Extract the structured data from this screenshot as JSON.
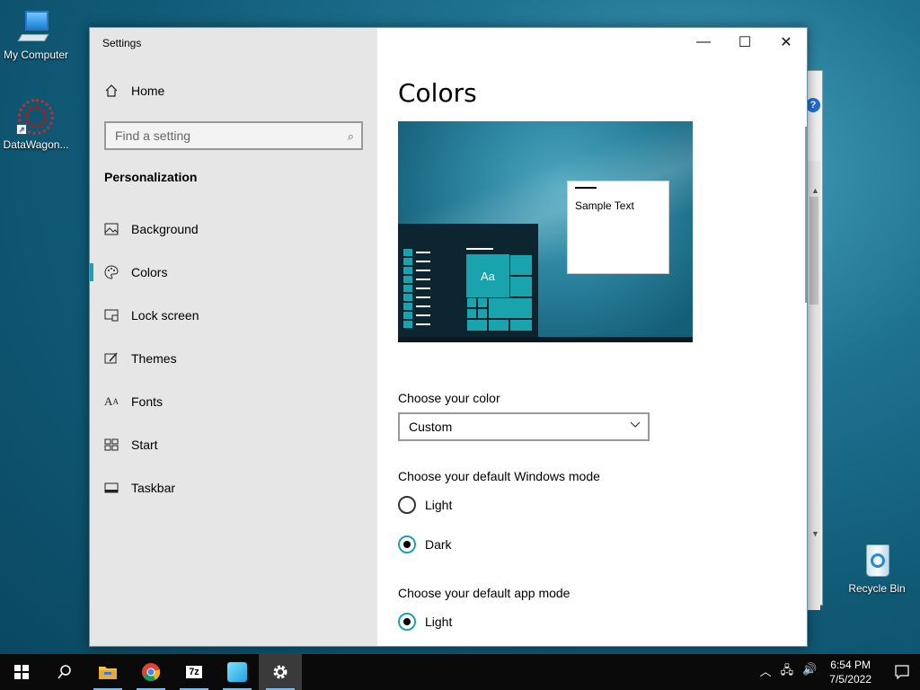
{
  "desktop": {
    "icons": [
      {
        "label": "My Computer"
      },
      {
        "label": "DataWagon..."
      },
      {
        "label": "Recycle Bin"
      }
    ]
  },
  "window": {
    "title": "Settings",
    "controls": {
      "minimize": "—",
      "maximize": "☐",
      "close": "✕"
    }
  },
  "sidebar": {
    "home_label": "Home",
    "search_placeholder": "Find a setting",
    "section": "Personalization",
    "items": [
      {
        "label": "Background",
        "icon": "image-icon"
      },
      {
        "label": "Colors",
        "icon": "palette-icon",
        "active": true
      },
      {
        "label": "Lock screen",
        "icon": "lock-screen-icon"
      },
      {
        "label": "Themes",
        "icon": "brush-icon"
      },
      {
        "label": "Fonts",
        "icon": "font-icon"
      },
      {
        "label": "Start",
        "icon": "start-icon"
      },
      {
        "label": "Taskbar",
        "icon": "taskbar-icon"
      }
    ]
  },
  "main": {
    "title": "Colors",
    "preview": {
      "sample_text": "Sample Text",
      "tile_text": "Aa"
    },
    "choose_color_label": "Choose your color",
    "choose_color_value": "Custom",
    "windows_mode_label": "Choose your default Windows mode",
    "windows_mode_options": [
      {
        "label": "Light",
        "checked": false
      },
      {
        "label": "Dark",
        "checked": true
      }
    ],
    "app_mode_label": "Choose your default app mode",
    "app_mode_options": [
      {
        "label": "Light",
        "checked": true
      }
    ]
  },
  "taskbar": {
    "apps": [
      "start-icon",
      "search-icon",
      "file-explorer-icon",
      "chrome-icon",
      "7zip-icon",
      "app-icon",
      "settings-icon"
    ],
    "time": "6:54 PM",
    "date": "7/5/2022"
  },
  "colors": {
    "accent": "#19a3ad"
  }
}
